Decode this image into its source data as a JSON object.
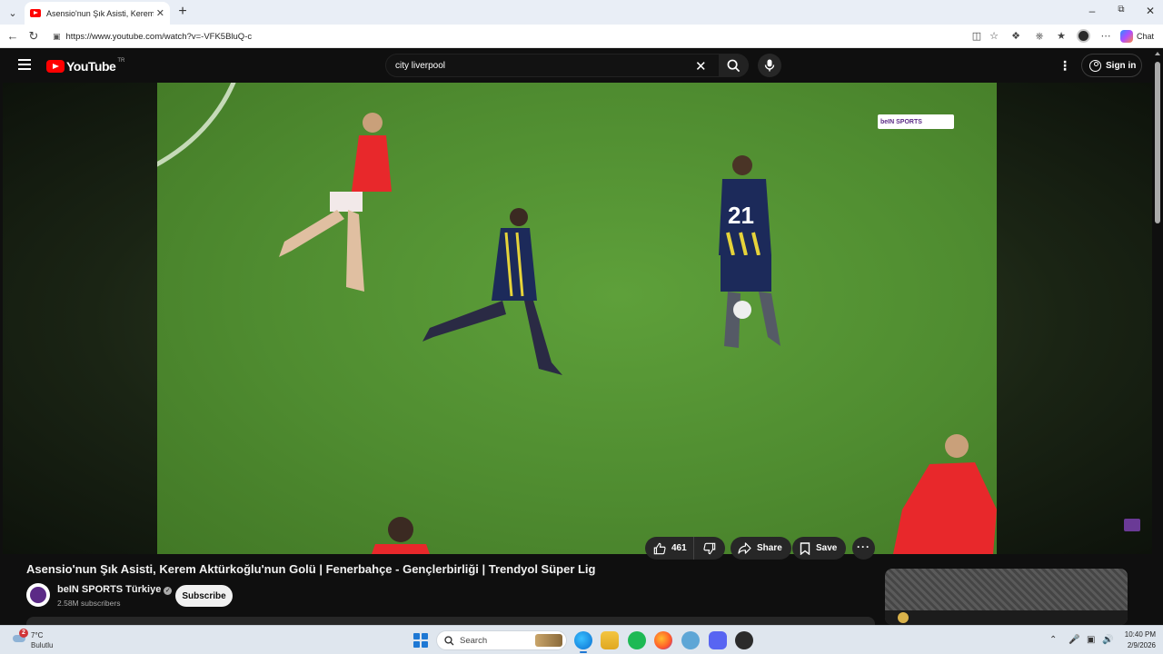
{
  "browser": {
    "tab_title": "Asensio'nun Şık Asisti, Kerem Aktü",
    "url": "https://www.youtube.com/watch?v=-VFK5BluQ-c",
    "chat_label": "Chat"
  },
  "youtube": {
    "logo_text": "YouTube",
    "country_code": "TR",
    "search_value": "city liverpool",
    "signin_label": "Sign in"
  },
  "video": {
    "title": "Asensio'nun Şık Asisti, Kerem Aktürkoğlu'nun Golü | Fenerbahçe - Gençlerbirliği | Trendyol Süper Lig",
    "broadcaster_logo": "beIN SPORTS"
  },
  "channel": {
    "name": "beIN SPORTS Türkiye",
    "subscribers": "2.58M subscribers",
    "subscribe_label": "Subscribe"
  },
  "actions": {
    "likes": "461",
    "share_label": "Share",
    "save_label": "Save"
  },
  "taskbar": {
    "weather_badge": "2",
    "temperature": "7°C",
    "condition": "Bulutlu",
    "search_label": "Search",
    "time": "10:40 PM",
    "date": "2/9/2026"
  },
  "colors": {
    "youtube_red": "#ff0000",
    "page_bg": "#0f0f0f",
    "bein_purple": "#5b2a86"
  }
}
